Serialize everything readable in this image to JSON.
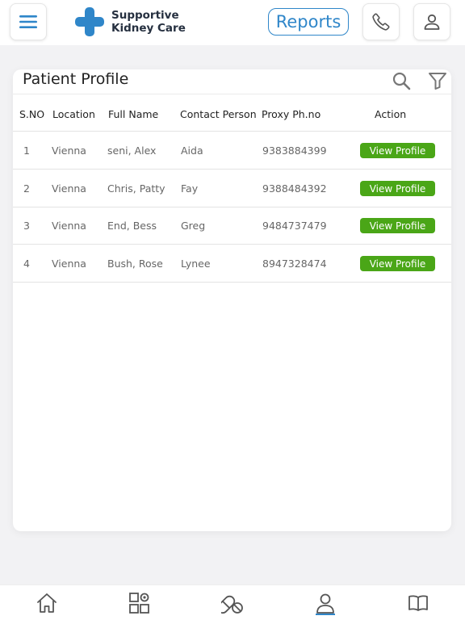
{
  "header": {
    "brand_line1": "Supportive",
    "brand_line2": "Kidney Care",
    "reports_label": "Reports",
    "menu_icon": "hamburger-menu-icon",
    "phone_icon": "phone-icon",
    "user_icon": "user-icon",
    "accent_color": "#2f86c9"
  },
  "card": {
    "title": "Patient Profile",
    "search_icon": "search-icon",
    "filter_icon": "filter-icon"
  },
  "table": {
    "headers": {
      "sno": "S.NO",
      "location": "Location",
      "full_name": "Full Name",
      "contact_person": "Contact Person",
      "proxy_phone": "Proxy Ph.no",
      "action": "Action"
    },
    "rows": [
      {
        "sno": "1",
        "location": "Vienna",
        "full_name": "seni, Alex",
        "contact_person": "Aida",
        "proxy_phone": "9383884399",
        "action": "View Profile"
      },
      {
        "sno": "2",
        "location": "Vienna",
        "full_name": "Chris, Patty",
        "contact_person": "Fay",
        "proxy_phone": "9388484392",
        "action": "View Profile"
      },
      {
        "sno": "3",
        "location": "Vienna",
        "full_name": "End, Bess",
        "contact_person": "Greg",
        "proxy_phone": "9484737479",
        "action": "View Profile"
      },
      {
        "sno": "4",
        "location": "Vienna",
        "full_name": "Bush, Rose",
        "contact_person": "Lynee",
        "proxy_phone": "8947328474",
        "action": "View Profile"
      }
    ],
    "action_color": "#4aa617"
  },
  "bottom_nav": {
    "items": [
      {
        "icon": "home-icon"
      },
      {
        "icon": "dashboard-grid-icon"
      },
      {
        "icon": "medication-icon"
      },
      {
        "icon": "patient-profile-icon",
        "active": true
      },
      {
        "icon": "book-icon"
      }
    ]
  }
}
